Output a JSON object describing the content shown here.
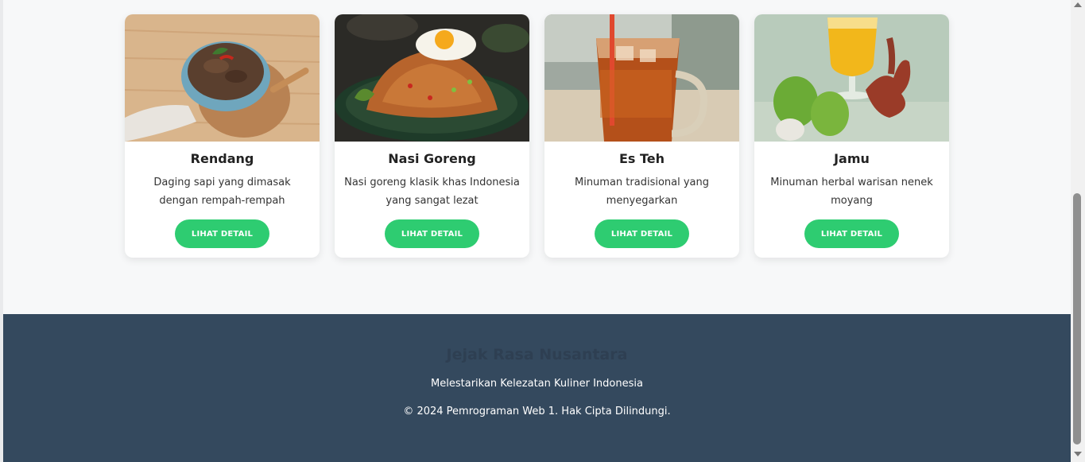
{
  "menu": {
    "items": [
      {
        "name": "Rendang",
        "description": "Daging sapi yang dimasak dengan rempah-rempah",
        "button_label": "LIHAT DETAIL",
        "icon": "rendang-photo"
      },
      {
        "name": "Nasi Goreng",
        "description": "Nasi goreng klasik khas Indonesia yang sangat lezat",
        "button_label": "LIHAT DETAIL",
        "icon": "nasi-goreng-photo"
      },
      {
        "name": "Es Teh",
        "description": "Minuman tradisional yang menyegarkan",
        "button_label": "LIHAT DETAIL",
        "icon": "es-teh-photo"
      },
      {
        "name": "Jamu",
        "description": "Minuman herbal warisan nenek moyang",
        "button_label": "LIHAT DETAIL",
        "icon": "jamu-photo"
      }
    ]
  },
  "footer": {
    "brand": "Jejak Rasa Nusantara",
    "tagline": "Melestarikan Kelezatan Kuliner Indonesia",
    "copyright": "© 2024 Pemrograman Web 1. Hak Cipta Dilindungi."
  },
  "colors": {
    "accent": "#2ecc71",
    "footer_bg": "#34495e",
    "page_bg": "#f7f8f9"
  }
}
